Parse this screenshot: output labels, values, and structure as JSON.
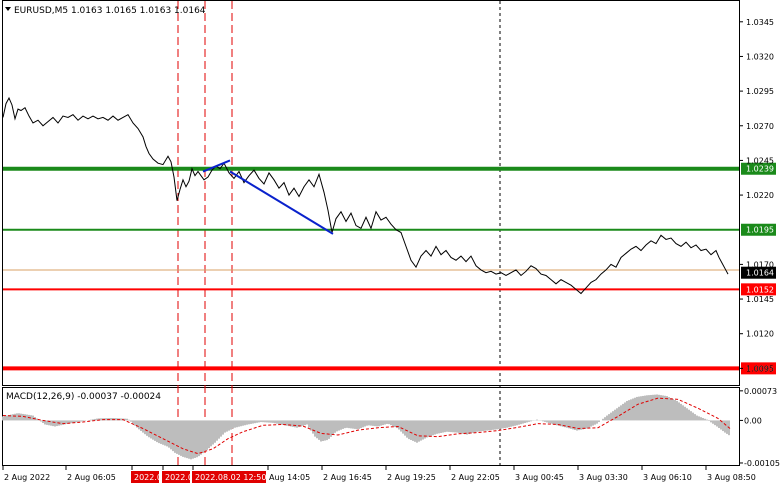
{
  "window": {
    "symbol_header": "EURUSD,M5  1.0163 1.0165 1.0163 1.0164",
    "macd_header": "MACD(12,26,9) -0.00037 -0.00024"
  },
  "colors": {
    "price_line": "#000000",
    "level_green": "#1a8a1a",
    "level_red": "#ff0000",
    "trend_blue": "#0a22cc",
    "macd_hist": "#bdbdbd",
    "macd_signal": "#e00000",
    "current_price_tag": "#000000"
  },
  "chart_data": [
    {
      "type": "line",
      "title": "EURUSD,M5",
      "ylim": [
        1.0083,
        1.036
      ],
      "y_ticks": [
        "1.0345",
        "1.0320",
        "1.0295",
        "1.0270",
        "1.0245",
        "1.0220",
        "1.0170",
        "1.0145",
        "1.0120",
        "1.0095"
      ],
      "x_tick_labels": [
        "2 Aug 2022",
        "2 Aug 06:05",
        "2022.0",
        "2022.0",
        "2022.08.02 12:50",
        "Aug 14:05",
        "2 Aug 16:45",
        "2 Aug 19:25",
        "2 Aug 22:05",
        "3 Aug 00:45",
        "3 Aug 03:30",
        "3 Aug 06:10",
        "3 Aug 08:50"
      ],
      "price_series": [
        [
          0,
          1.0276
        ],
        [
          3,
          1.0286
        ],
        [
          6,
          1.029
        ],
        [
          9,
          1.0285
        ],
        [
          12,
          1.0275
        ],
        [
          15,
          1.0282
        ],
        [
          18,
          1.0281
        ],
        [
          22,
          1.0283
        ],
        [
          26,
          1.0277
        ],
        [
          30,
          1.0272
        ],
        [
          35,
          1.0274
        ],
        [
          40,
          1.027
        ],
        [
          45,
          1.0273
        ],
        [
          50,
          1.0276
        ],
        [
          55,
          1.0272
        ],
        [
          60,
          1.0277
        ],
        [
          65,
          1.0276
        ],
        [
          70,
          1.0278
        ],
        [
          75,
          1.0274
        ],
        [
          80,
          1.0277
        ],
        [
          85,
          1.0275
        ],
        [
          90,
          1.0277
        ],
        [
          95,
          1.0275
        ],
        [
          100,
          1.0276
        ],
        [
          105,
          1.0274
        ],
        [
          110,
          1.0277
        ],
        [
          115,
          1.0274
        ],
        [
          120,
          1.0276
        ],
        [
          125,
          1.0278
        ],
        [
          130,
          1.0272
        ],
        [
          135,
          1.0268
        ],
        [
          140,
          1.0262
        ],
        [
          143,
          1.0255
        ],
        [
          146,
          1.025
        ],
        [
          150,
          1.0246
        ],
        [
          155,
          1.0243
        ],
        [
          160,
          1.0242
        ],
        [
          165,
          1.0248
        ],
        [
          168,
          1.0244
        ],
        [
          171,
          1.0233
        ],
        [
          174,
          1.0216
        ],
        [
          177,
          1.0224
        ],
        [
          180,
          1.0231
        ],
        [
          183,
          1.0226
        ],
        [
          186,
          1.023
        ],
        [
          189,
          1.0239
        ],
        [
          192,
          1.0234
        ],
        [
          195,
          1.0237
        ],
        [
          198,
          1.0234
        ],
        [
          201,
          1.0231
        ],
        [
          205,
          1.0233
        ],
        [
          209,
          1.0238
        ],
        [
          213,
          1.0241
        ],
        [
          217,
          1.0239
        ],
        [
          221,
          1.0243
        ],
        [
          226,
          1.0236
        ],
        [
          231,
          1.0232
        ],
        [
          236,
          1.0237
        ],
        [
          241,
          1.0229
        ],
        [
          246,
          1.0234
        ],
        [
          251,
          1.0238
        ],
        [
          256,
          1.0232
        ],
        [
          261,
          1.0228
        ],
        [
          266,
          1.0236
        ],
        [
          271,
          1.0231
        ],
        [
          276,
          1.0225
        ],
        [
          281,
          1.0229
        ],
        [
          286,
          1.022
        ],
        [
          291,
          1.0225
        ],
        [
          296,
          1.0219
        ],
        [
          301,
          1.0226
        ],
        [
          306,
          1.0231
        ],
        [
          311,
          1.0226
        ],
        [
          316,
          1.0235
        ],
        [
          321,
          1.0222
        ],
        [
          325,
          1.0209
        ],
        [
          329,
          1.0193
        ],
        [
          333,
          1.0203
        ],
        [
          338,
          1.0208
        ],
        [
          343,
          1.0201
        ],
        [
          348,
          1.0207
        ],
        [
          353,
          1.0198
        ],
        [
          358,
          1.0196
        ],
        [
          363,
          1.0204
        ],
        [
          368,
          1.0196
        ],
        [
          373,
          1.0208
        ],
        [
          378,
          1.0202
        ],
        [
          383,
          1.0204
        ],
        [
          388,
          1.0199
        ],
        [
          393,
          1.0195
        ],
        [
          398,
          1.0193
        ],
        [
          403,
          1.0183
        ],
        [
          408,
          1.0173
        ],
        [
          413,
          1.0168
        ],
        [
          418,
          1.0176
        ],
        [
          423,
          1.018
        ],
        [
          428,
          1.0176
        ],
        [
          433,
          1.0183
        ],
        [
          438,
          1.0177
        ],
        [
          443,
          1.018
        ],
        [
          448,
          1.0175
        ],
        [
          453,
          1.0173
        ],
        [
          458,
          1.0176
        ],
        [
          463,
          1.0172
        ],
        [
          468,
          1.0176
        ],
        [
          473,
          1.0169
        ],
        [
          478,
          1.0166
        ],
        [
          483,
          1.0164
        ],
        [
          488,
          1.0165
        ],
        [
          493,
          1.0163
        ],
        [
          498,
          1.0164
        ],
        [
          503,
          1.0162
        ],
        [
          508,
          1.0164
        ],
        [
          513,
          1.0166
        ],
        [
          518,
          1.0162
        ],
        [
          523,
          1.0165
        ],
        [
          528,
          1.0169
        ],
        [
          533,
          1.0167
        ],
        [
          538,
          1.0163
        ],
        [
          543,
          1.0162
        ],
        [
          548,
          1.0159
        ],
        [
          553,
          1.0156
        ],
        [
          558,
          1.0159
        ],
        [
          563,
          1.0157
        ],
        [
          568,
          1.0155
        ],
        [
          573,
          1.0152
        ],
        [
          578,
          1.0149
        ],
        [
          583,
          1.0153
        ],
        [
          588,
          1.0157
        ],
        [
          593,
          1.0159
        ],
        [
          598,
          1.0163
        ],
        [
          603,
          1.0166
        ],
        [
          608,
          1.017
        ],
        [
          613,
          1.0168
        ],
        [
          618,
          1.0175
        ],
        [
          623,
          1.0178
        ],
        [
          628,
          1.0181
        ],
        [
          633,
          1.0183
        ],
        [
          638,
          1.018
        ],
        [
          643,
          1.0184
        ],
        [
          648,
          1.0187
        ],
        [
          653,
          1.0185
        ],
        [
          658,
          1.0191
        ],
        [
          663,
          1.0188
        ],
        [
          668,
          1.0189
        ],
        [
          673,
          1.0185
        ],
        [
          678,
          1.0183
        ],
        [
          683,
          1.0186
        ],
        [
          688,
          1.0182
        ],
        [
          693,
          1.0184
        ],
        [
          698,
          1.018
        ],
        [
          703,
          1.0181
        ],
        [
          708,
          1.0177
        ],
        [
          713,
          1.018
        ],
        [
          716,
          1.0175
        ],
        [
          719,
          1.0171
        ],
        [
          722,
          1.0167
        ],
        [
          725,
          1.0163
        ]
      ],
      "levels": [
        {
          "price": 1.0239,
          "label": "1.0239",
          "color": "#1a8a1a",
          "kind": "thick"
        },
        {
          "price": 1.0195,
          "label": "1.0195",
          "color": "#1a8a1a",
          "kind": "normal"
        },
        {
          "price": 1.0152,
          "label": "1.0152",
          "color": "#ff0000",
          "kind": "normal"
        },
        {
          "price": 1.0095,
          "label": "1.0095",
          "color": "#ff0000",
          "kind": "thick"
        }
      ],
      "current_price": {
        "price": 1.0164,
        "label": "1.0164"
      },
      "bid_line_price": 1.0166,
      "trend_lines": [
        {
          "from": [
            200,
            1.0237
          ],
          "to": [
            227,
            1.0245
          ]
        },
        {
          "from": [
            227,
            1.0237
          ],
          "to": [
            330,
            1.0192
          ]
        }
      ],
      "vertical_markers": [
        175,
        202,
        229
      ],
      "dotted_marker": 497
    },
    {
      "type": "bar",
      "title": "MACD(12,26,9)",
      "ylim": [
        -0.0011,
        0.0008
      ],
      "y_ticks": [
        "0.00073",
        "0.00",
        "-0.00105"
      ],
      "histogram": [
        [
          0,
          0.0001
        ],
        [
          15,
          0.00018
        ],
        [
          30,
          0.00012
        ],
        [
          42,
          -0.0001
        ],
        [
          52,
          -0.00015
        ],
        [
          65,
          -8e-05
        ],
        [
          80,
          -2e-05
        ],
        [
          95,
          5e-05
        ],
        [
          110,
          6e-05
        ],
        [
          125,
          4e-05
        ],
        [
          135,
          -0.0002
        ],
        [
          145,
          -0.0004
        ],
        [
          155,
          -0.00055
        ],
        [
          165,
          -0.00065
        ],
        [
          172,
          -0.0008
        ],
        [
          180,
          -0.0009
        ],
        [
          188,
          -0.00096
        ],
        [
          195,
          -0.0009
        ],
        [
          203,
          -0.00075
        ],
        [
          212,
          -0.00055
        ],
        [
          222,
          -0.0003
        ],
        [
          232,
          -0.00018
        ],
        [
          245,
          -0.0001
        ],
        [
          258,
          -4e-05
        ],
        [
          270,
          -6e-05
        ],
        [
          282,
          -0.00012
        ],
        [
          294,
          -0.00018
        ],
        [
          304,
          -0.0001
        ],
        [
          312,
          -0.0004
        ],
        [
          318,
          -0.00052
        ],
        [
          325,
          -0.00048
        ],
        [
          333,
          -0.00028
        ],
        [
          343,
          -0.00018
        ],
        [
          355,
          -0.00022
        ],
        [
          365,
          -0.00012
        ],
        [
          375,
          -0.00015
        ],
        [
          385,
          -8e-05
        ],
        [
          395,
          -0.0002
        ],
        [
          405,
          -0.00045
        ],
        [
          414,
          -0.00055
        ],
        [
          424,
          -0.00042
        ],
        [
          434,
          -0.00033
        ],
        [
          444,
          -0.00028
        ],
        [
          454,
          -0.0003
        ],
        [
          464,
          -0.00035
        ],
        [
          474,
          -0.00028
        ],
        [
          484,
          -0.00025
        ],
        [
          494,
          -0.00022
        ],
        [
          504,
          -0.00018
        ],
        [
          514,
          -0.00012
        ],
        [
          524,
          -5e-05
        ],
        [
          534,
          2e-05
        ],
        [
          544,
          -5e-05
        ],
        [
          554,
          -0.00012
        ],
        [
          564,
          -0.00018
        ],
        [
          574,
          -0.00025
        ],
        [
          584,
          -0.0002
        ],
        [
          594,
          -8e-05
        ],
        [
          604,
          0.00012
        ],
        [
          614,
          0.0003
        ],
        [
          624,
          0.00048
        ],
        [
          634,
          0.00058
        ],
        [
          644,
          0.00062
        ],
        [
          654,
          0.00064
        ],
        [
          664,
          0.0006
        ],
        [
          674,
          0.00048
        ],
        [
          684,
          0.0003
        ],
        [
          694,
          0.00012
        ],
        [
          704,
          2e-05
        ],
        [
          714,
          -0.00015
        ],
        [
          722,
          -0.0003
        ],
        [
          727,
          -0.00038
        ]
      ],
      "signal": [
        [
          0,
          0.00012
        ],
        [
          20,
          0.0001
        ],
        [
          40,
          0.0
        ],
        [
          60,
          -8e-05
        ],
        [
          80,
          -4e-05
        ],
        [
          100,
          2e-05
        ],
        [
          120,
          2e-05
        ],
        [
          140,
          -0.0002
        ],
        [
          160,
          -0.00045
        ],
        [
          180,
          -0.0007
        ],
        [
          195,
          -0.00082
        ],
        [
          210,
          -0.0007
        ],
        [
          225,
          -0.00045
        ],
        [
          240,
          -0.00028
        ],
        [
          260,
          -0.00012
        ],
        [
          280,
          -0.0001
        ],
        [
          300,
          -0.00014
        ],
        [
          318,
          -0.00032
        ],
        [
          335,
          -0.00036
        ],
        [
          355,
          -0.00024
        ],
        [
          375,
          -0.00018
        ],
        [
          395,
          -0.00015
        ],
        [
          415,
          -0.00038
        ],
        [
          435,
          -0.0004
        ],
        [
          455,
          -0.00033
        ],
        [
          475,
          -0.0003
        ],
        [
          495,
          -0.00025
        ],
        [
          515,
          -0.00017
        ],
        [
          535,
          -8e-05
        ],
        [
          555,
          -0.0001
        ],
        [
          575,
          -0.0002
        ],
        [
          595,
          -0.00018
        ],
        [
          615,
          0.0001
        ],
        [
          635,
          0.0004
        ],
        [
          655,
          0.00055
        ],
        [
          675,
          0.00052
        ],
        [
          695,
          0.0003
        ],
        [
          715,
          5e-05
        ],
        [
          727,
          -0.0002
        ]
      ]
    }
  ]
}
